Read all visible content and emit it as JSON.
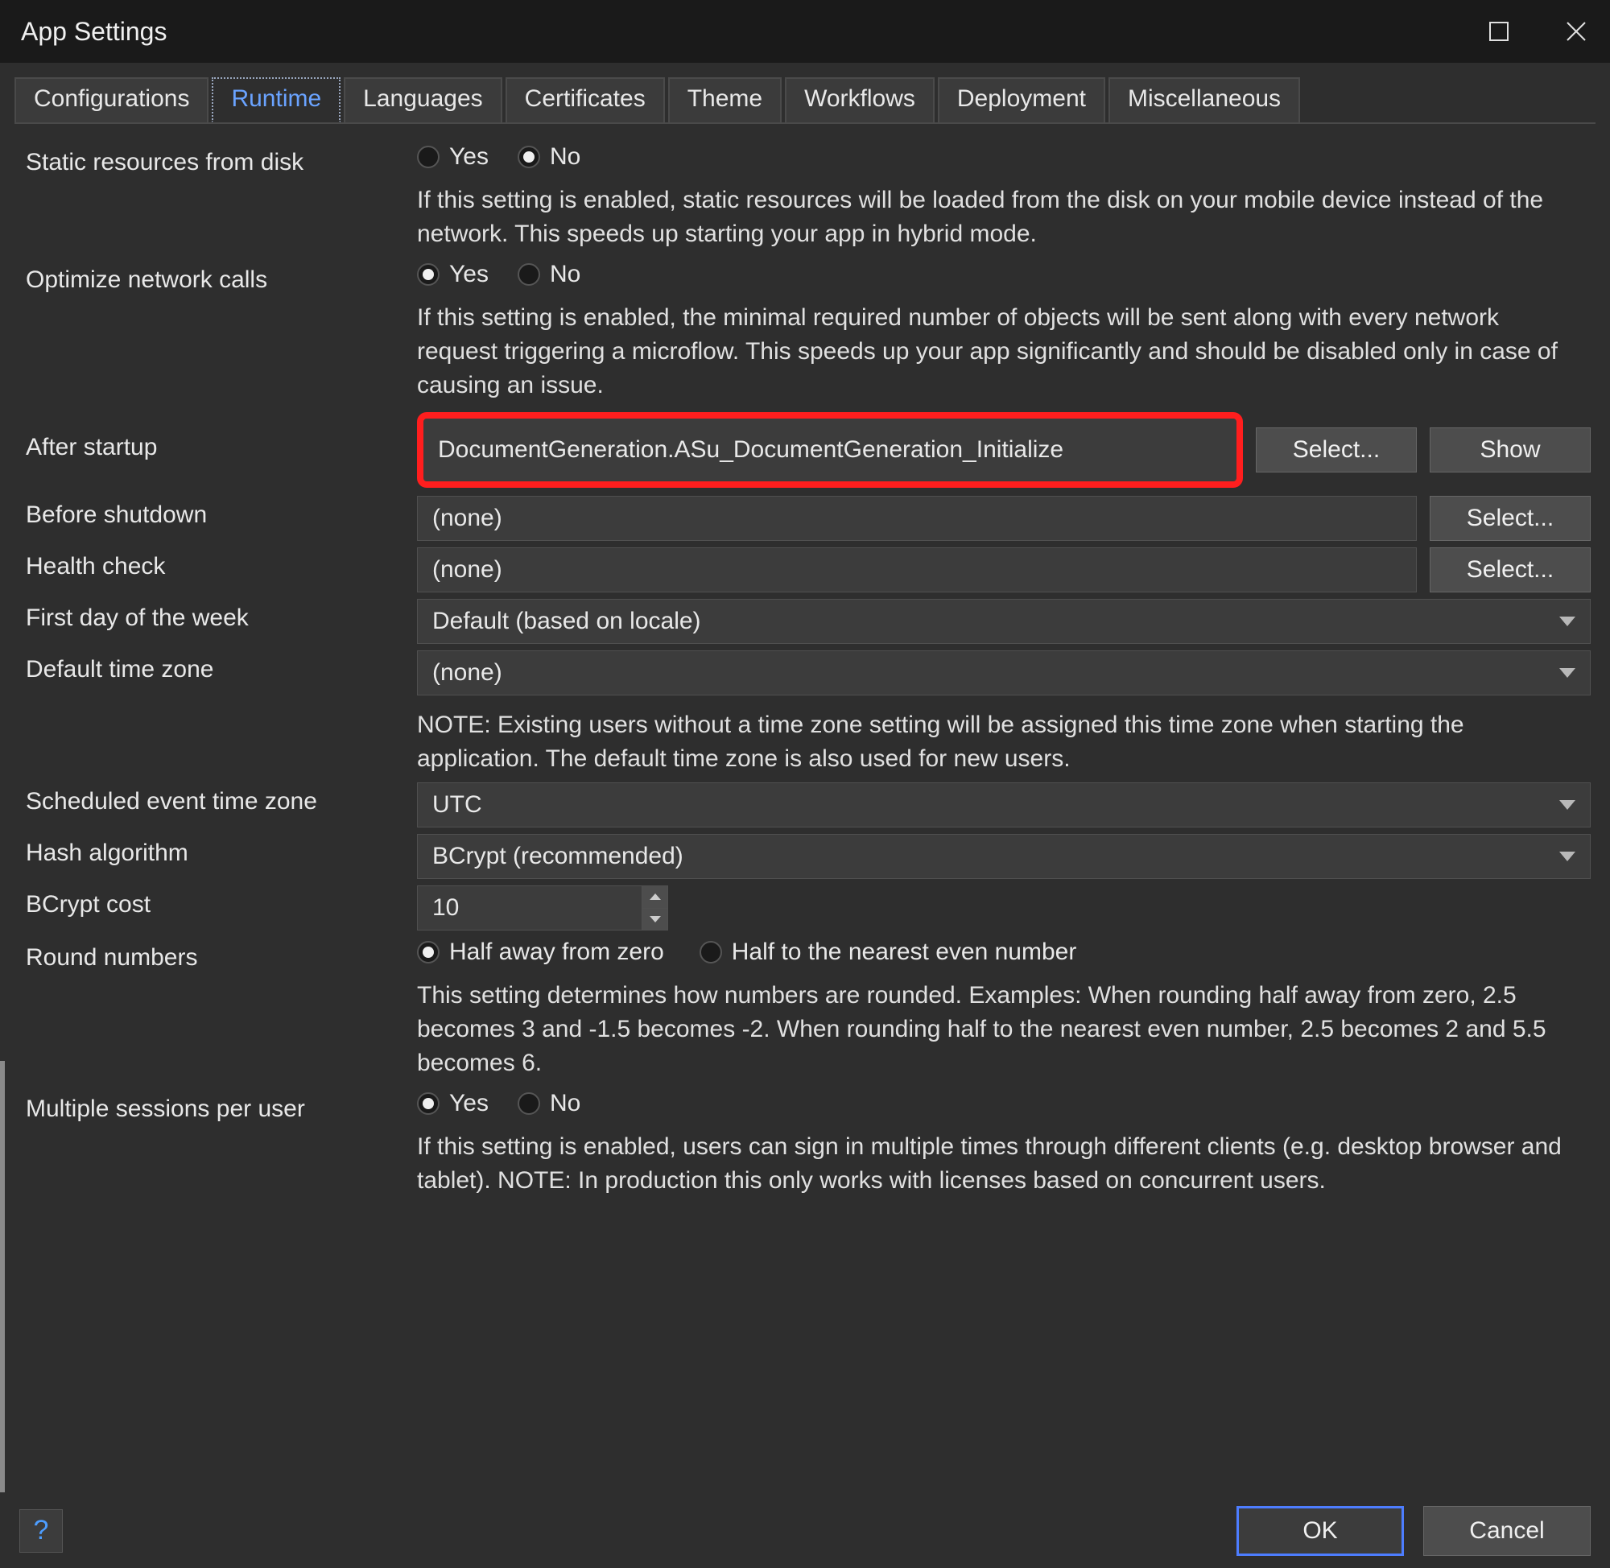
{
  "window": {
    "title": "App Settings"
  },
  "tabs": {
    "configurations": "Configurations",
    "runtime": "Runtime",
    "languages": "Languages",
    "certificates": "Certificates",
    "theme": "Theme",
    "workflows": "Workflows",
    "deployment": "Deployment",
    "misc": "Miscellaneous"
  },
  "radio_labels": {
    "yes": "Yes",
    "no": "No"
  },
  "static_resources": {
    "label": "Static resources from disk",
    "value": "No",
    "desc": "If this setting is enabled, static resources will be loaded from the disk on your mobile device instead of the network. This speeds up starting your app in hybrid mode."
  },
  "optimize_network": {
    "label": "Optimize network calls",
    "value": "Yes",
    "desc": "If this setting is enabled, the minimal required number of objects will be sent along with every network request triggering a microflow. This speeds up your app significantly and should be disabled only in case of causing an issue."
  },
  "after_startup": {
    "label": "After startup",
    "value": "DocumentGeneration.ASu_DocumentGeneration_Initialize",
    "select_btn": "Select...",
    "show_btn": "Show"
  },
  "before_shutdown": {
    "label": "Before shutdown",
    "value": "(none)",
    "select_btn": "Select..."
  },
  "health_check": {
    "label": "Health check",
    "value": "(none)",
    "select_btn": "Select..."
  },
  "first_day": {
    "label": "First day of the week",
    "value": "Default (based on locale)"
  },
  "default_tz": {
    "label": "Default time zone",
    "value": "(none)",
    "desc": "NOTE: Existing users without a time zone setting will be assigned this time zone when starting the application. The default time zone is also used for new users."
  },
  "sched_tz": {
    "label": "Scheduled event time zone",
    "value": "UTC"
  },
  "hash_algo": {
    "label": "Hash algorithm",
    "value": "BCrypt (recommended)"
  },
  "bcrypt_cost": {
    "label": "BCrypt cost",
    "value": "10"
  },
  "round_numbers": {
    "label": "Round numbers",
    "opt1": "Half away from zero",
    "opt2": "Half to the nearest even number",
    "value": "Half away from zero",
    "desc": "This setting determines how numbers are rounded. Examples: When rounding half away from zero, 2.5 becomes 3 and -1.5 becomes -2. When rounding half to the nearest even number, 2.5 becomes 2 and 5.5 becomes 6."
  },
  "multi_sessions": {
    "label": "Multiple sessions per user",
    "value": "Yes",
    "desc": "If this setting is enabled, users can sign in multiple times through different clients (e.g. desktop browser and tablet). NOTE: In production this only works with licenses based on concurrent users."
  },
  "footer": {
    "help": "?",
    "ok": "OK",
    "cancel": "Cancel"
  }
}
